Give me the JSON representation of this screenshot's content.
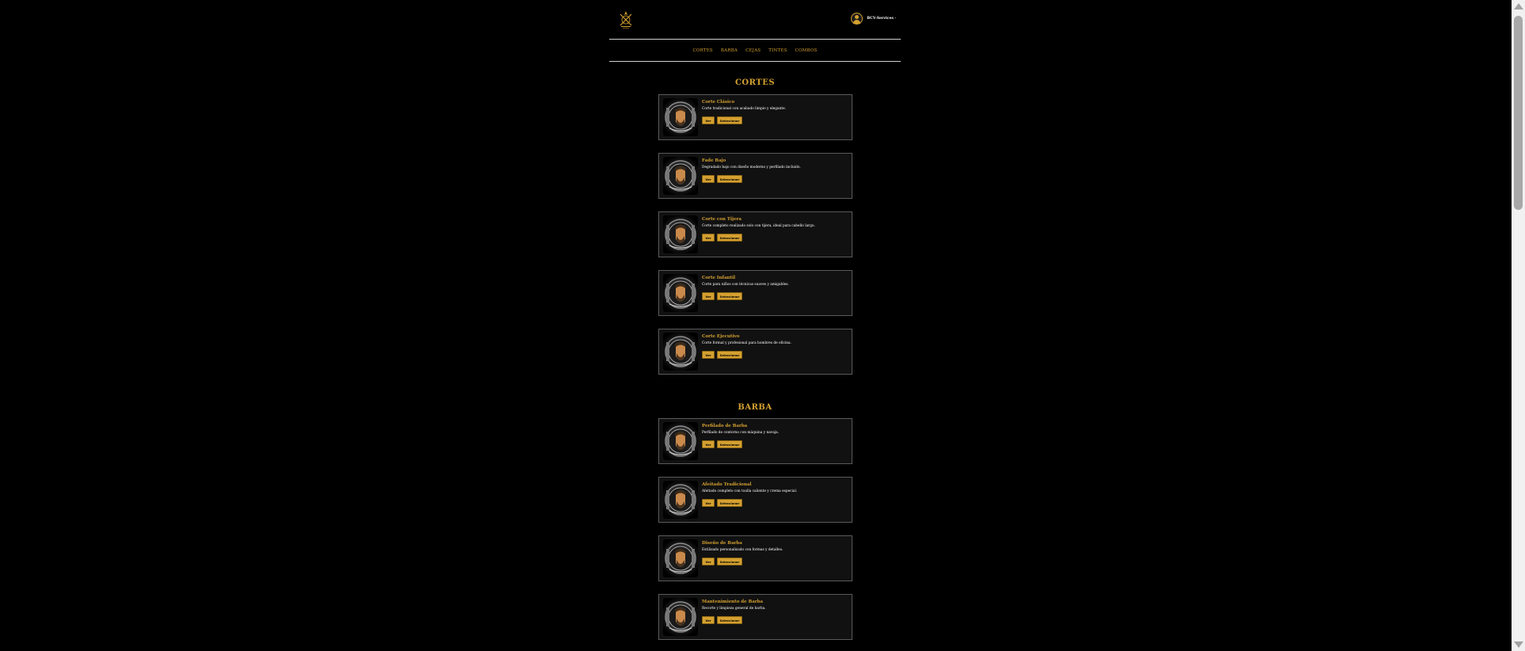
{
  "header": {
    "user_name": "BCV-Services ·"
  },
  "nav": {
    "items": [
      "CORTES",
      "BARBA",
      "CEJAS",
      "TINTES",
      "COMBOS"
    ]
  },
  "sections": {
    "cortes": {
      "title": "CORTES",
      "cards": [
        {
          "title": "Corte Clásico",
          "desc": "Corte tradicional con acabado limpio y elegante.",
          "ver": "Ver",
          "select": "Seleccionar"
        },
        {
          "title": "Fade Bajo",
          "desc": "Degradado bajo con diseño moderno y perfilado incluido.",
          "ver": "Ver",
          "select": "Seleccionar"
        },
        {
          "title": "Corte con Tijera",
          "desc": "Corte completo realizado solo con tijera, ideal para cabello largo.",
          "ver": "Ver",
          "select": "Seleccionar"
        },
        {
          "title": "Corte Infantil",
          "desc": "Corte para niños con técnicas suaves y amigables.",
          "ver": "Ver",
          "select": "Seleccionar"
        },
        {
          "title": "Corte Ejecutivo",
          "desc": "Corte formal y profesional para hombres de oficina.",
          "ver": "Ver",
          "select": "Seleccionar"
        }
      ]
    },
    "barba": {
      "title": "BARBA",
      "cards": [
        {
          "title": "Perfilado de Barba",
          "desc": "Perfilado de contorno con máquina y navaja.",
          "ver": "Ver",
          "select": "Seleccionar"
        },
        {
          "title": "Afeitado Tradicional",
          "desc": "Afeitado completo con toalla caliente y crema especial.",
          "ver": "Ver",
          "select": "Seleccionar"
        },
        {
          "title": "Diseño de Barba",
          "desc": "Estilizado personalizado con formas y detalles.",
          "ver": "Ver",
          "select": "Seleccionar"
        },
        {
          "title": "Mantenimiento de Barba",
          "desc": "Recorte y limpieza general de barba.",
          "ver": "Ver",
          "select": "Seleccionar"
        }
      ]
    }
  },
  "colors": {
    "accent": "#d4a030",
    "background": "#000000",
    "card_bg": "#111111"
  }
}
